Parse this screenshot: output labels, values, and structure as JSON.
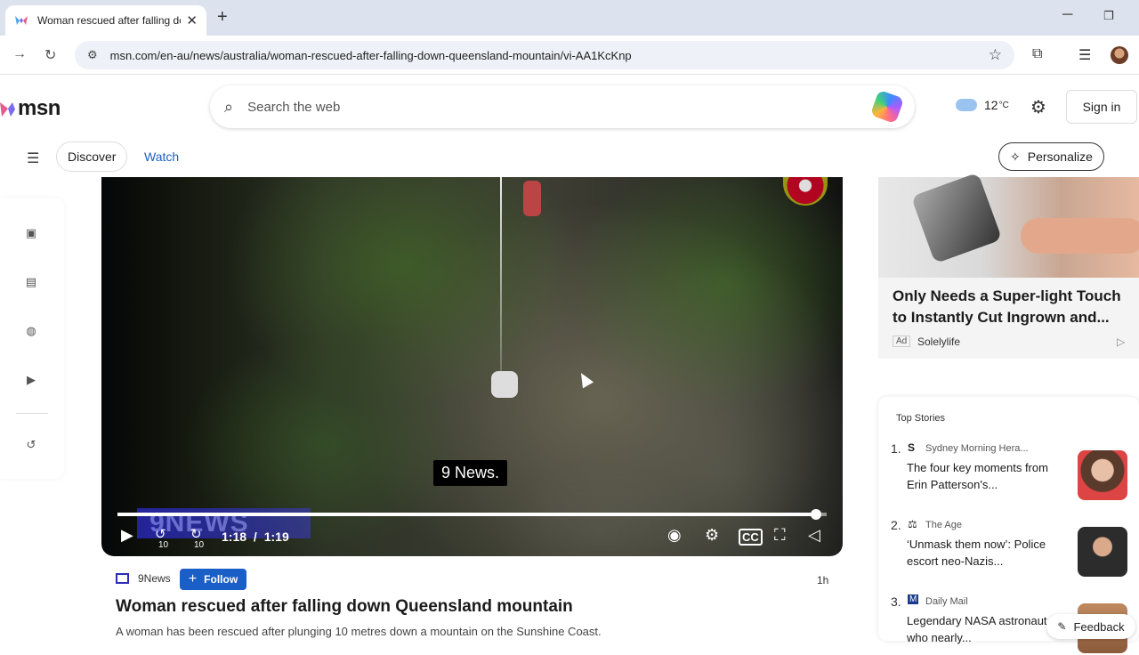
{
  "browser": {
    "tab_title": "Woman rescued after falling do",
    "url": "msn.com/en-au/news/australia/woman-rescued-after-falling-down-queensland-mountain/vi-AA1KcKnp"
  },
  "header": {
    "logo_text": "msn",
    "search_placeholder": "Search the web",
    "temperature": "12",
    "temp_unit": "°C",
    "signin_label": "Sign in"
  },
  "nav": {
    "discover_label": "Discover",
    "watch_label": "Watch",
    "personalize_label": "Personalize"
  },
  "video": {
    "caption": "9 News.",
    "watermark": "9NEWS",
    "current_time": "1:18",
    "separator": "/",
    "duration": "1:19",
    "progress_fraction": 0.985,
    "skip_back_label": "10",
    "skip_fwd_label": "10"
  },
  "article": {
    "source": "9News",
    "follow_label": "Follow",
    "time_ago": "1h",
    "headline": "Woman rescued after falling down Queensland mountain",
    "summary": "A woman has been rescued after plunging 10 metres down a mountain on the Sunshine Coast."
  },
  "ad": {
    "title": "Only Needs a Super-light Touch to Instantly Cut Ingrown and...",
    "tag": "Ad",
    "sponsor": "Solelylife"
  },
  "top_stories": {
    "header": "Top Stories",
    "items": [
      {
        "num": "1.",
        "source": "Sydney Morning Hera...",
        "title": "The four key moments from Erin Patterson's..."
      },
      {
        "num": "2.",
        "source": "The Age",
        "title": "‘Unmask them now’: Police escort neo-Nazis..."
      },
      {
        "num": "3.",
        "source": "Daily Mail",
        "title": "Legendary NASA astronaut who nearly..."
      }
    ]
  },
  "feedback_label": "Feedback",
  "colors": {
    "accent": "#1a5fc7",
    "chrome_tabbar": "#dde3ee"
  }
}
